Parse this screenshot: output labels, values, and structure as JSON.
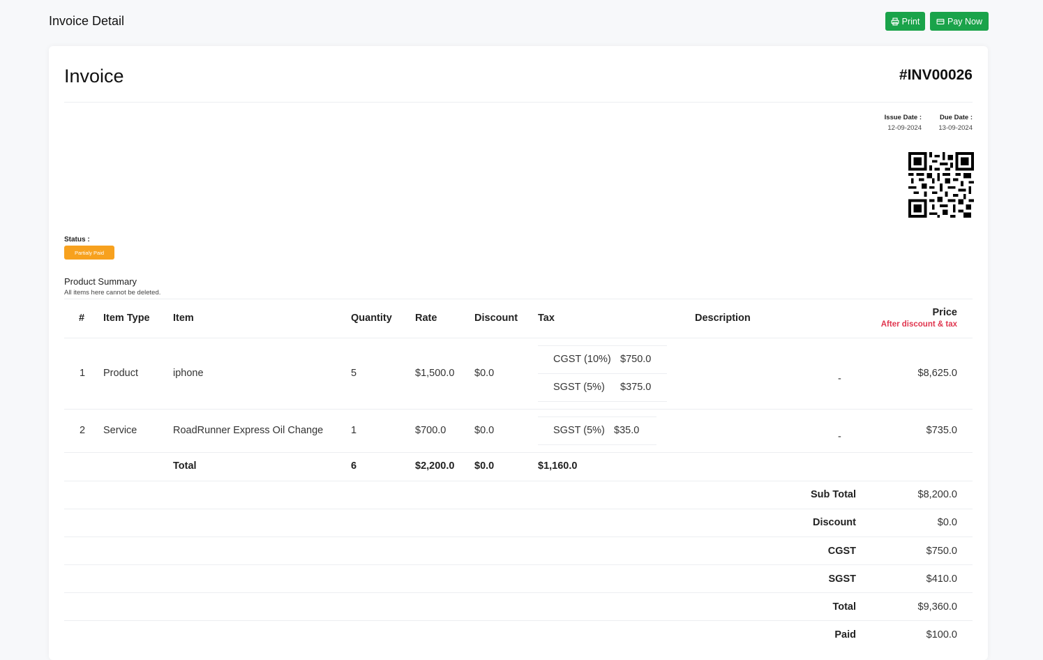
{
  "header": {
    "page_title": "Invoice Detail",
    "print_label": "Print",
    "pay_label": "Pay Now",
    "accent": "#1aa34a"
  },
  "invoice": {
    "title": "Invoice",
    "number": "#INV00026",
    "issue_date_label": "Issue Date :",
    "issue_date": "12-09-2024",
    "due_date_label": "Due Date :",
    "due_date": "13-09-2024",
    "status_label": "Status :",
    "status": "Partialy Paid",
    "status_color": "#f7a11e"
  },
  "summary": {
    "title": "Product Summary",
    "subtitle": "All items here cannot be deleted."
  },
  "table": {
    "headers": {
      "num": "#",
      "item_type": "Item Type",
      "item": "Item",
      "quantity": "Quantity",
      "rate": "Rate",
      "discount": "Discount",
      "tax": "Tax",
      "description": "Description",
      "price": "Price",
      "price_sub": "After discount & tax"
    },
    "rows": [
      {
        "num": "1",
        "item_type": "Product",
        "item": "iphone",
        "quantity": "5",
        "rate": "$1,500.0",
        "discount": "$0.0",
        "taxes": [
          {
            "name": "CGST (10%)",
            "amount": "$750.0"
          },
          {
            "name": "SGST (5%)",
            "amount": "$375.0"
          }
        ],
        "description": "-",
        "price": "$8,625.0"
      },
      {
        "num": "2",
        "item_type": "Service",
        "item": "RoadRunner Express Oil Change",
        "quantity": "1",
        "rate": "$700.0",
        "discount": "$0.0",
        "taxes": [
          {
            "name": "SGST (5%)",
            "amount": "$35.0"
          }
        ],
        "description": "-",
        "price": "$735.0"
      }
    ],
    "total": {
      "label": "Total",
      "quantity": "6",
      "rate": "$2,200.0",
      "discount": "$0.0",
      "tax": "$1,160.0"
    }
  },
  "totals": [
    {
      "label": "Sub Total",
      "value": "$8,200.0"
    },
    {
      "label": "Discount",
      "value": "$0.0"
    },
    {
      "label": "CGST",
      "value": "$750.0"
    },
    {
      "label": "SGST",
      "value": "$410.0"
    },
    {
      "label": "Total",
      "value": "$9,360.0"
    },
    {
      "label": "Paid",
      "value": "$100.0"
    }
  ]
}
